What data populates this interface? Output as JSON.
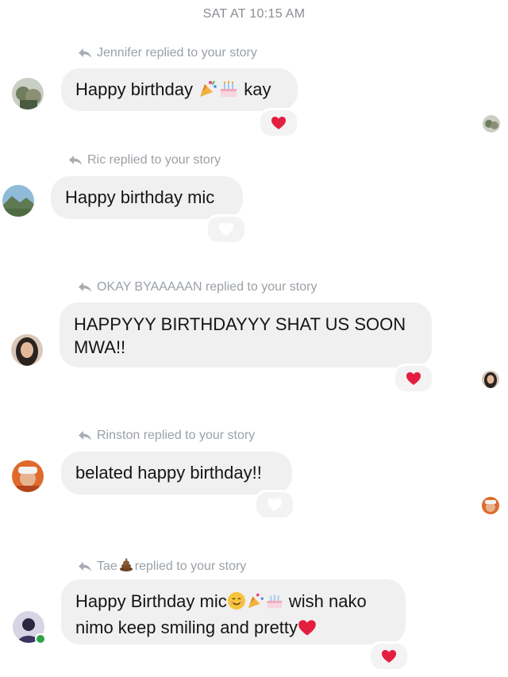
{
  "header": {
    "timestamp": "SAT AT 10:15 AM"
  },
  "colors": {
    "bubble": "#f0f0f0",
    "heart": "#e41e3f",
    "label": "#9aa0a6",
    "online": "#31a24c"
  },
  "messages": [
    {
      "reply_label": "Jennifer replied to your story",
      "text_a": "Happy birthday ",
      "emoji_a": [
        "party-popper-icon",
        "cake-icon"
      ],
      "text_b": " kay",
      "reaction": "heart",
      "reaction_filled": true
    },
    {
      "reply_label": "Ric replied to your story",
      "text": "Happy birthday mic",
      "reaction": "heart",
      "reaction_filled": false
    },
    {
      "reply_label": "OKAY BYAAAAAN replied to your story",
      "line1": "HAPPYYY BIRTHDAYYY SHAT US SOON",
      "line2": "MWA!!",
      "reaction": "heart",
      "reaction_filled": true
    },
    {
      "reply_label": "Rinston replied to your story",
      "text": "belated happy birthday!!",
      "reaction": "heart",
      "reaction_filled": false
    },
    {
      "reply_label_a": "Tae ",
      "reply_label_emoji": "pile-of-poo-icon",
      "reply_label_b": " replied to your story",
      "line1_a": "Happy Birthday mic",
      "line1_emoji": [
        "smiling-face-icon",
        "party-popper-icon",
        "cake-icon"
      ],
      "line1_b": " wish nako",
      "line2_a": "nimo keep smiling and pretty",
      "line2_emoji": "red-heart-icon",
      "reaction": "heart",
      "reaction_filled": true
    }
  ]
}
